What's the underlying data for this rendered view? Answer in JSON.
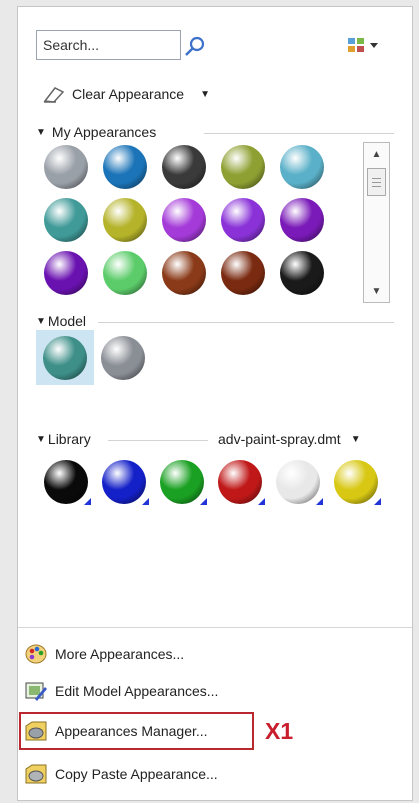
{
  "search": {
    "placeholder": "Search..."
  },
  "toolbar": {
    "clear_label": "Clear Appearance"
  },
  "my_appearances": {
    "label": "My Appearances",
    "colors": [
      "#9aa0a8",
      "#1b74b8",
      "#3a3a3a",
      "#8ea032",
      "#5ab0c8",
      "#3f9a98",
      "#b5b32a",
      "#a43ad8",
      "#8a32d8",
      "#7a1ab8",
      "#6a12b0",
      "#5ccc6a",
      "#8a3a18",
      "#7a2a10",
      "#1a1a1a"
    ]
  },
  "model": {
    "label": "Model",
    "colors": [
      "#3d8f88",
      "#8a8f96"
    ]
  },
  "library": {
    "label": "Library",
    "file": "adv-paint-spray.dmt",
    "colors": [
      "#0a0a0a",
      "#1420c8",
      "#1aa022",
      "#c01818",
      "#e8e8e8",
      "#d8c814"
    ]
  },
  "menu": [
    {
      "label": "More Appearances...",
      "icon": "palette-icon"
    },
    {
      "label": "Edit Model Appearances...",
      "icon": "edit-appearance-icon"
    },
    {
      "label": "Appearances Manager...",
      "icon": "appearance-manager-icon"
    },
    {
      "label": "Copy Paste Appearance...",
      "icon": "copy-paste-appearance-icon"
    }
  ],
  "annotation": {
    "label": "X1",
    "color": "#c81e2d"
  }
}
